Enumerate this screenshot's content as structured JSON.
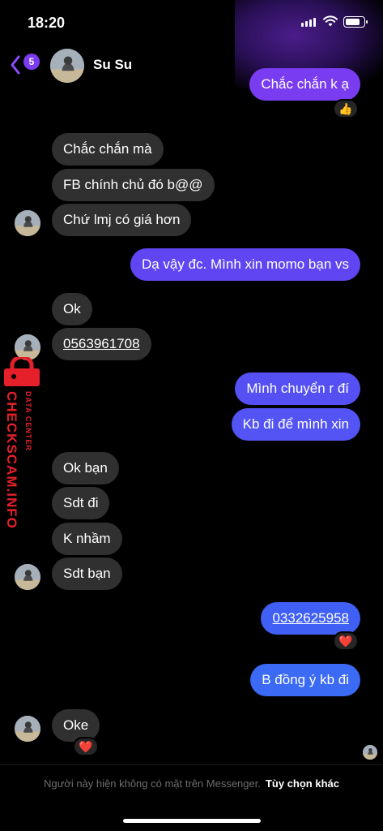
{
  "status_bar": {
    "time": "18:20"
  },
  "header": {
    "back_badge": "5",
    "contact_name": "Su Su"
  },
  "messages": [
    {
      "text": "Chắc chắn k ạ",
      "reaction": "👍"
    },
    {
      "text": "Chắc chắn mà"
    },
    {
      "text": "FB chính chủ đó b@@"
    },
    {
      "text": "Chứ lmj có giá hơn"
    },
    {
      "text": "Dạ vậy đc. Mình xin momo bạn vs"
    },
    {
      "text": "Ok"
    },
    {
      "text": "0563961708"
    },
    {
      "text": "Mình chuyển r đí"
    },
    {
      "text": "Kb đi để mình xin"
    },
    {
      "text": "Ok bạn"
    },
    {
      "text": "Sdt đi"
    },
    {
      "text": "K nhầm"
    },
    {
      "text": "Sdt bạn"
    },
    {
      "text": "0332625958",
      "reaction": "❤️"
    },
    {
      "text": "B đồng ý kb đi"
    },
    {
      "text": "Oke",
      "reaction": "❤️"
    }
  ],
  "footer": {
    "notice": "Người này hiện không có mặt trên Messenger.",
    "options_link": "Tùy chọn khác"
  },
  "watermark": {
    "brand": "CHECKSCAM.INFO",
    "tagline": "DATA CENTER"
  },
  "colors": {
    "incoming_bubble": "#303030",
    "outgoing_top": "#7a3cf0",
    "outgoing_bottom": "#3b6af5",
    "badge": "#7b3cf0",
    "watermark": "#e6202a"
  }
}
